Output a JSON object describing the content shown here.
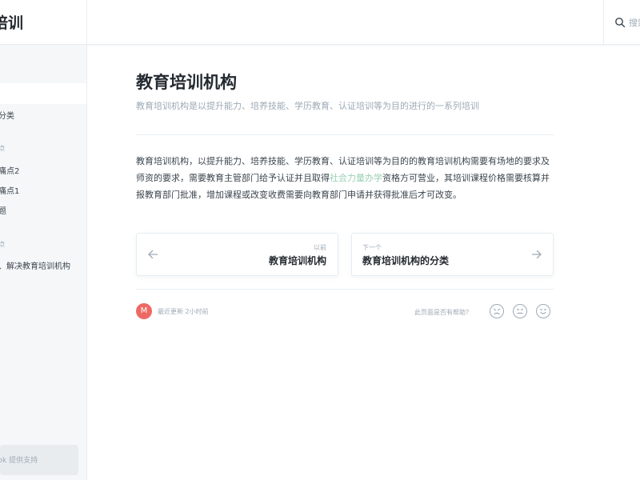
{
  "header": {
    "brand_title": "培训",
    "search_placeholder": "搜索"
  },
  "sidebar": {
    "items": [
      {
        "label": "分类"
      },
      {
        "label": "痛点2"
      },
      {
        "label": "痛点1"
      },
      {
        "label": "题"
      },
      {
        "label": "、解决教育培训机构"
      }
    ],
    "groups": [
      "点",
      "点"
    ],
    "footer_text": "ook 提供支持"
  },
  "article": {
    "title": "教育培训机构",
    "subtitle": "教育培训机构是以提升能力、培养技能、学历教育、认证培训等为目的进行的一系列培训",
    "body_before_link": "教育培训机构，以提升能力、培养技能、学历教育、认证培训等为目的的教育培训机构需要有场地的要求及师资的要求，需要教育主管部门给予认证并且取得",
    "body_link": "社会力量办学",
    "body_after_link": "资格方可营业，其培训课程价格需要核算并报教育部门批准，增加课程或改变收费需要向教育部门申请并获得批准后才可改变。"
  },
  "pagination": {
    "prev_small": "以前",
    "prev_label": "教育培训机构",
    "next_small": "下一个",
    "next_label": "教育培训机构的分类"
  },
  "footer": {
    "avatar_letter": "M",
    "updated_text": "最近更新 2小时前",
    "helpful_text": "此页面是否有帮助？"
  }
}
